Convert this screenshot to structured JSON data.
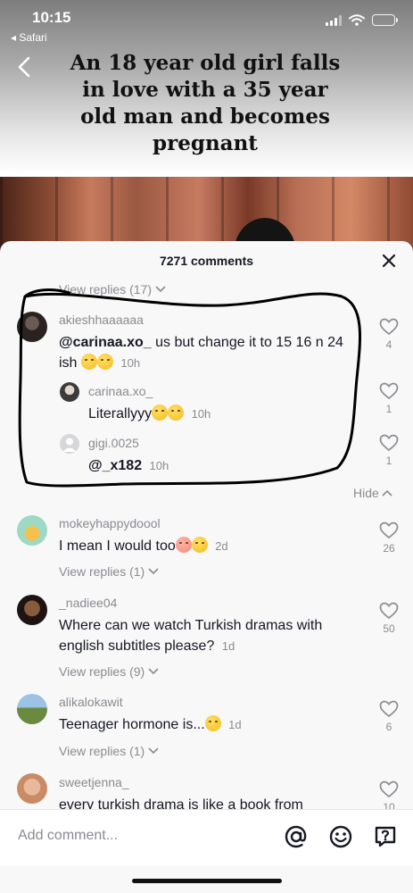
{
  "status": {
    "time": "10:15",
    "back_app": "◂ Safari"
  },
  "video": {
    "title": "An 18 year old girl falls in love with a 35 year old man and becomes pregnant"
  },
  "comments_sheet": {
    "title": "7271 comments",
    "top_view_replies": "View replies (17)",
    "hide_label": "Hide",
    "comments": [
      {
        "username": "akieshhaaaaaa",
        "mention": "@carinaa.xo_",
        "text": " us but change it to 15 16 n 24 ish",
        "time": "10h",
        "likes": "4"
      },
      {
        "username": "carinaa.xo_",
        "text": "Literallyyy",
        "time": "10h",
        "likes": "1"
      },
      {
        "username": "gigi.0025",
        "mention": "@_x182",
        "time": "10h",
        "likes": "1"
      },
      {
        "username": "mokeyhappydoool",
        "text": "I mean I would too",
        "time": "2d",
        "likes": "26",
        "view_replies": "View replies (1)"
      },
      {
        "username": "_nadiee04",
        "text": "Where can we watch Turkish dramas with english subtitles please?",
        "time": "1d",
        "likes": "50",
        "view_replies": "View replies (9)"
      },
      {
        "username": "alikalokawit",
        "text": "Teenager hormone is...",
        "time": "1d",
        "likes": "6",
        "view_replies": "View replies (1)"
      },
      {
        "username": "sweetjenna_",
        "text": "every turkish drama is like a book from",
        "likes": "10"
      }
    ]
  },
  "input": {
    "placeholder": "Add comment..."
  },
  "icons": [
    "back-chevron-icon",
    "close-icon",
    "heart-icon",
    "chevron-down-icon",
    "chevron-up-icon",
    "at-sign-icon",
    "emoji-icon",
    "question-icon",
    "signal-icon",
    "wifi-icon",
    "battery-icon"
  ],
  "colors": {
    "sheet_bg": "#f8f8f8",
    "secondary_text": "#8a8b91",
    "primary_text": "#161823",
    "battery": "#f5c318"
  }
}
